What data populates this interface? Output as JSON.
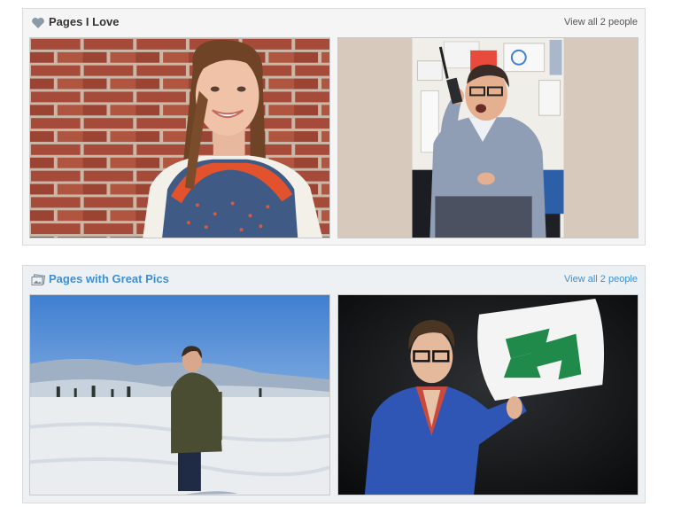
{
  "sections": [
    {
      "title": "Pages I Love",
      "icon": "heart-icon",
      "view_all": "View all 2 people",
      "photos": [
        {
          "name": "woman-brick-wall-photo"
        },
        {
          "name": "man-walkie-talkie-photo"
        }
      ]
    },
    {
      "title": "Pages with Great Pics",
      "icon": "photos-icon",
      "view_all": "View all 2 people",
      "photos": [
        {
          "name": "man-snowfield-photo"
        },
        {
          "name": "man-arrow-pillow-photo"
        }
      ]
    }
  ],
  "colors": {
    "panel_border": "#d9dcdf",
    "link_blue": "#3d8fd1",
    "title_dark": "#333333"
  }
}
